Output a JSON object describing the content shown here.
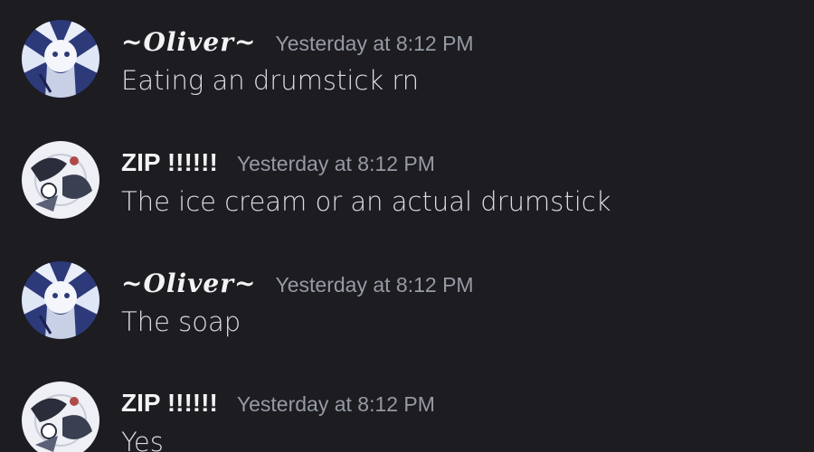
{
  "colors": {
    "background": "#1c1c21",
    "username": "#f2f3f5",
    "timestamp": "#969aa3",
    "message_text": "#dcdde1"
  },
  "messages": [
    {
      "author": "~Oliver~",
      "timestamp": "Yesterday at 8:12 PM",
      "text": "Eating an drumstick rn",
      "avatar_icon": "oliver-avatar-icon"
    },
    {
      "author": "ZIP !!!!!!",
      "timestamp": "Yesterday at 8:12 PM",
      "text": "The ice cream or an actual drumstick",
      "avatar_icon": "zip-avatar-icon"
    },
    {
      "author": "~Oliver~",
      "timestamp": "Yesterday at 8:12 PM",
      "text": "The soap",
      "avatar_icon": "oliver-avatar-icon"
    },
    {
      "author": "ZIP !!!!!!",
      "timestamp": "Yesterday at 8:12 PM",
      "text": "Yes",
      "avatar_icon": "zip-avatar-icon"
    }
  ]
}
